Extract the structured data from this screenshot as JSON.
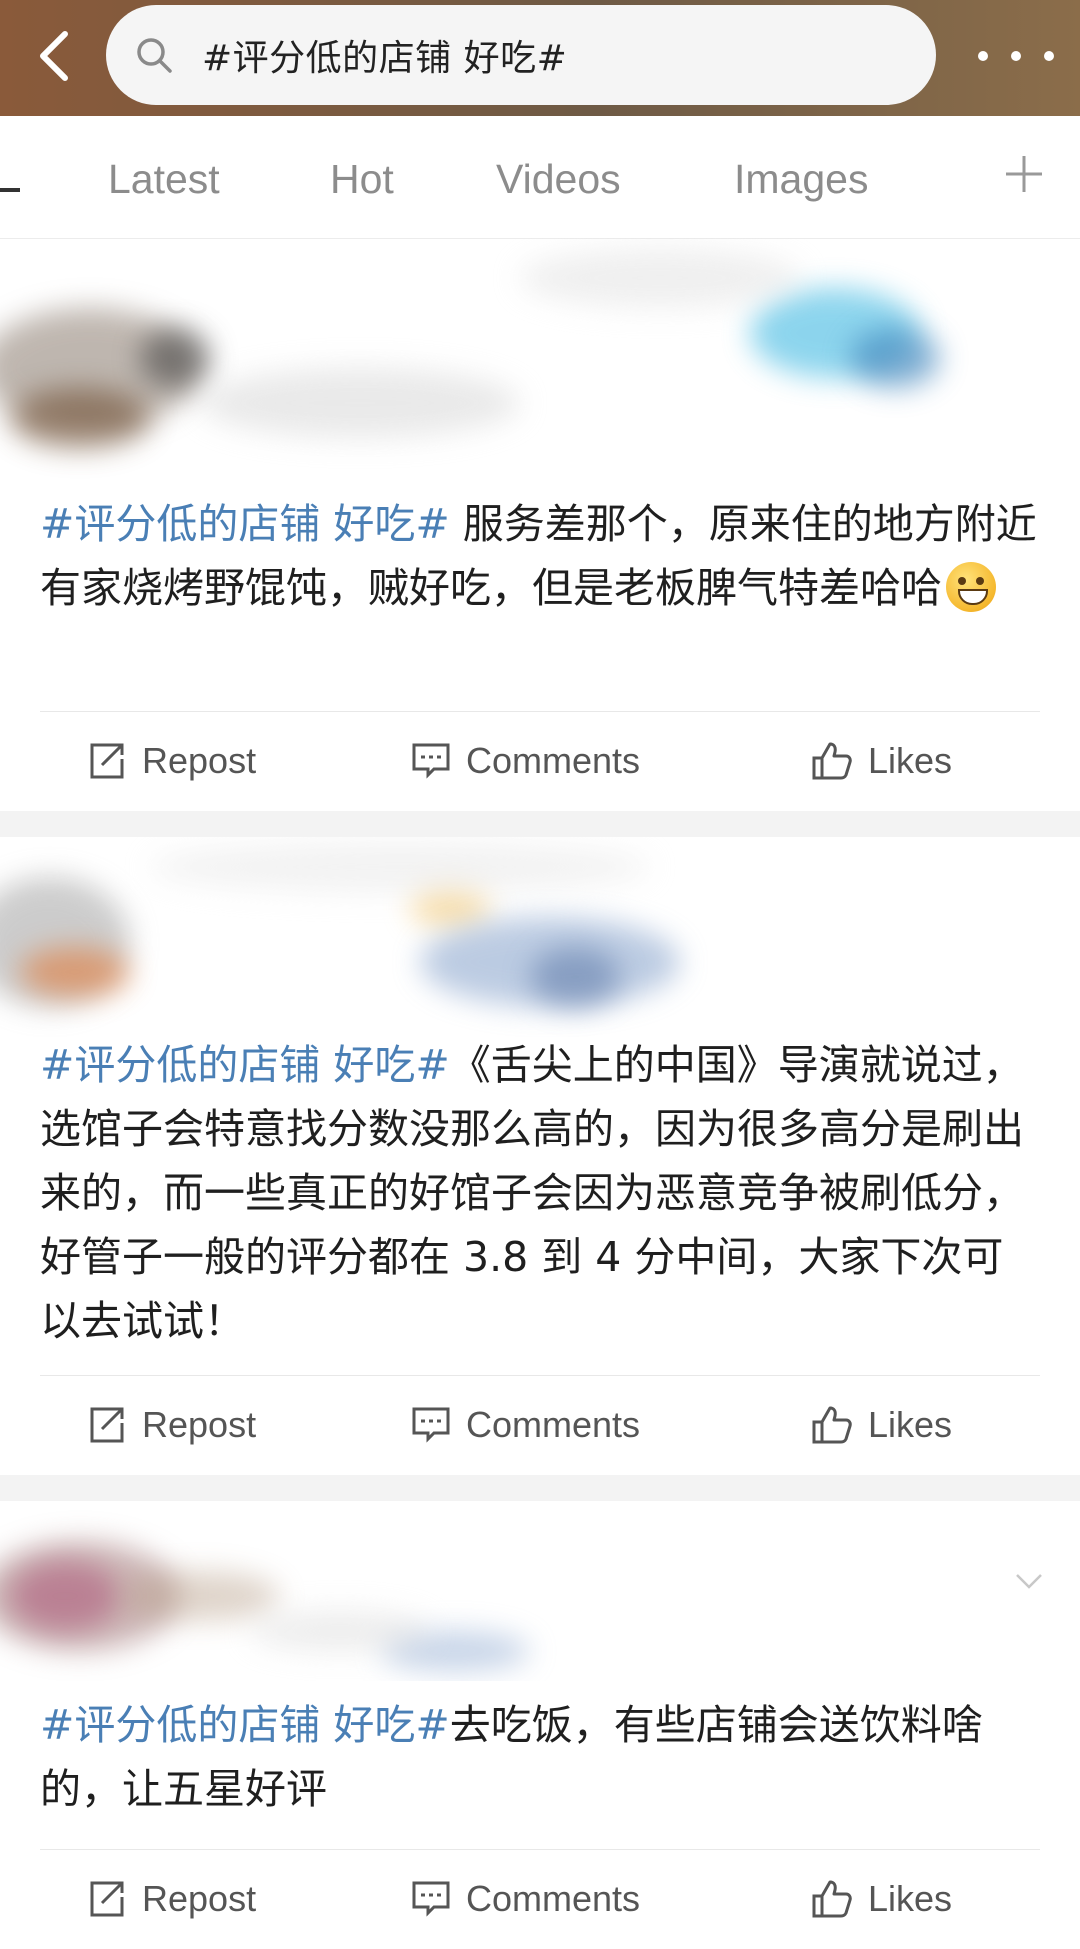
{
  "header": {
    "search_query": "#评分低的店铺 好吃#"
  },
  "tabs": [
    {
      "label": "Latest"
    },
    {
      "label": "Hot"
    },
    {
      "label": "Videos"
    },
    {
      "label": "Images"
    }
  ],
  "posts": [
    {
      "hashtag": "#评分低的店铺 好吃#",
      "body": " 服务差那个，原来住的地方附近有家烧烤野馄饨，贼好吃，但是老板脾气特差哈哈",
      "has_emoji": true,
      "actions": {
        "repost": "Repost",
        "comments": "Comments",
        "likes": "Likes"
      }
    },
    {
      "hashtag": "#评分低的店铺 好吃#",
      "body": "《舌尖上的中国》导演就说过，选馆子会特意找分数没那么高的，因为很多高分是刷出来的，而一些真正的好馆子会因为恶意竞争被刷低分，好管子一般的评分都在 3.8 到 4 分中间，大家下次可以去试试！",
      "actions": {
        "repost": "Repost",
        "comments": "Comments",
        "likes": "Likes"
      }
    },
    {
      "hashtag": "#评分低的店铺 好吃#",
      "body": "去吃饭，有些店铺会送饮料啥的，让五星好评",
      "actions": {
        "repost": "Repost",
        "comments": "Comments",
        "likes": "Likes"
      }
    }
  ],
  "colors": {
    "hashtag": "#4a7fb5",
    "tab_inactive": "#8c8c8c",
    "header_bg": "#7a5e44"
  }
}
